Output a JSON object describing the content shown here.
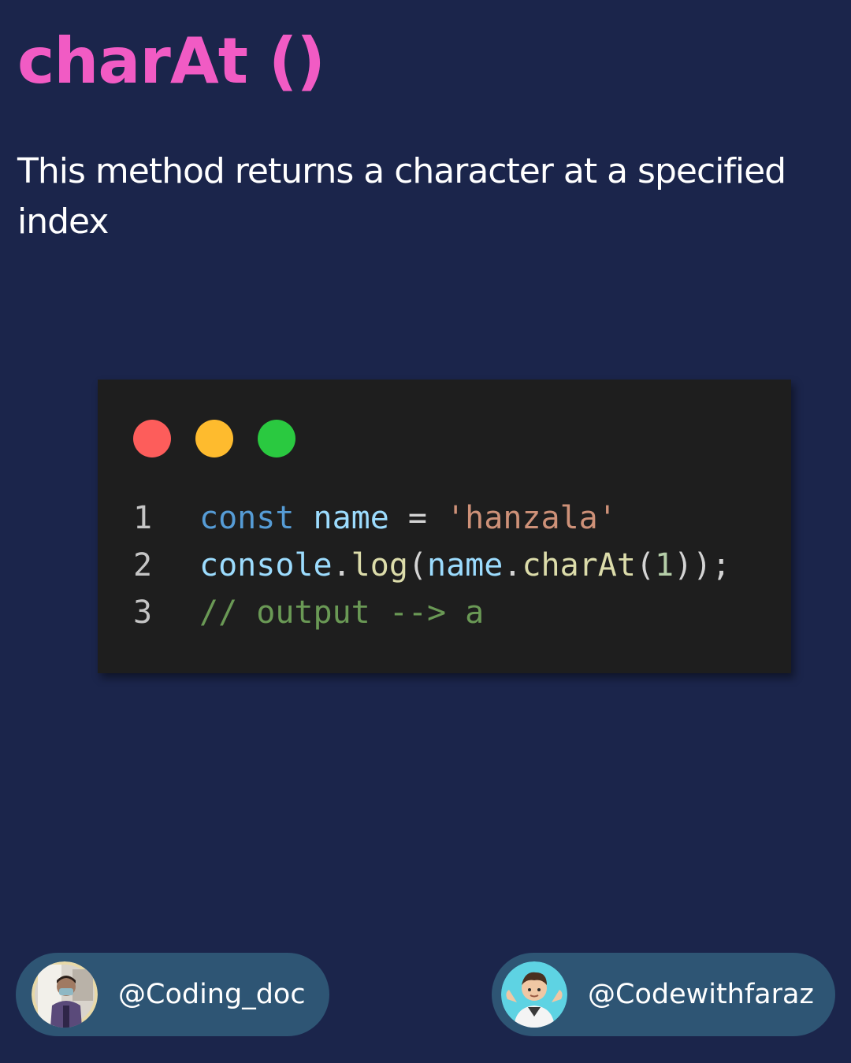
{
  "title": "charAt ()",
  "description": "This method returns a character at a specified index",
  "code_window": {
    "dots": [
      "red",
      "yellow",
      "green"
    ],
    "lines": [
      {
        "number": "1",
        "tokens": [
          {
            "text": "const ",
            "type": "kw"
          },
          {
            "text": "name",
            "type": "var"
          },
          {
            "text": " = ",
            "type": "op"
          },
          {
            "text": "'hanzala'",
            "type": "str"
          }
        ]
      },
      {
        "number": "2",
        "tokens": [
          {
            "text": "console",
            "type": "var"
          },
          {
            "text": ".",
            "type": "op"
          },
          {
            "text": "log",
            "type": "fn"
          },
          {
            "text": "(",
            "type": "op"
          },
          {
            "text": "name",
            "type": "var"
          },
          {
            "text": ".",
            "type": "op"
          },
          {
            "text": "charAt",
            "type": "fn"
          },
          {
            "text": "(",
            "type": "op"
          },
          {
            "text": "1",
            "type": "num"
          },
          {
            "text": "));",
            "type": "op"
          }
        ]
      },
      {
        "number": "3",
        "tokens": [
          {
            "text": "// output --> a",
            "type": "cmt"
          }
        ]
      }
    ]
  },
  "badges": {
    "left": {
      "handle": "@Coding_doc",
      "avatar_icon": "profile-photo-avatar"
    },
    "right": {
      "handle": "@Codewithfaraz",
      "avatar_icon": "shrug-memoji-avatar"
    }
  },
  "colors": {
    "background": "#1b254b",
    "title": "#f15bc4",
    "badge": "#2e5574",
    "code_background": "#1e1e1e"
  }
}
